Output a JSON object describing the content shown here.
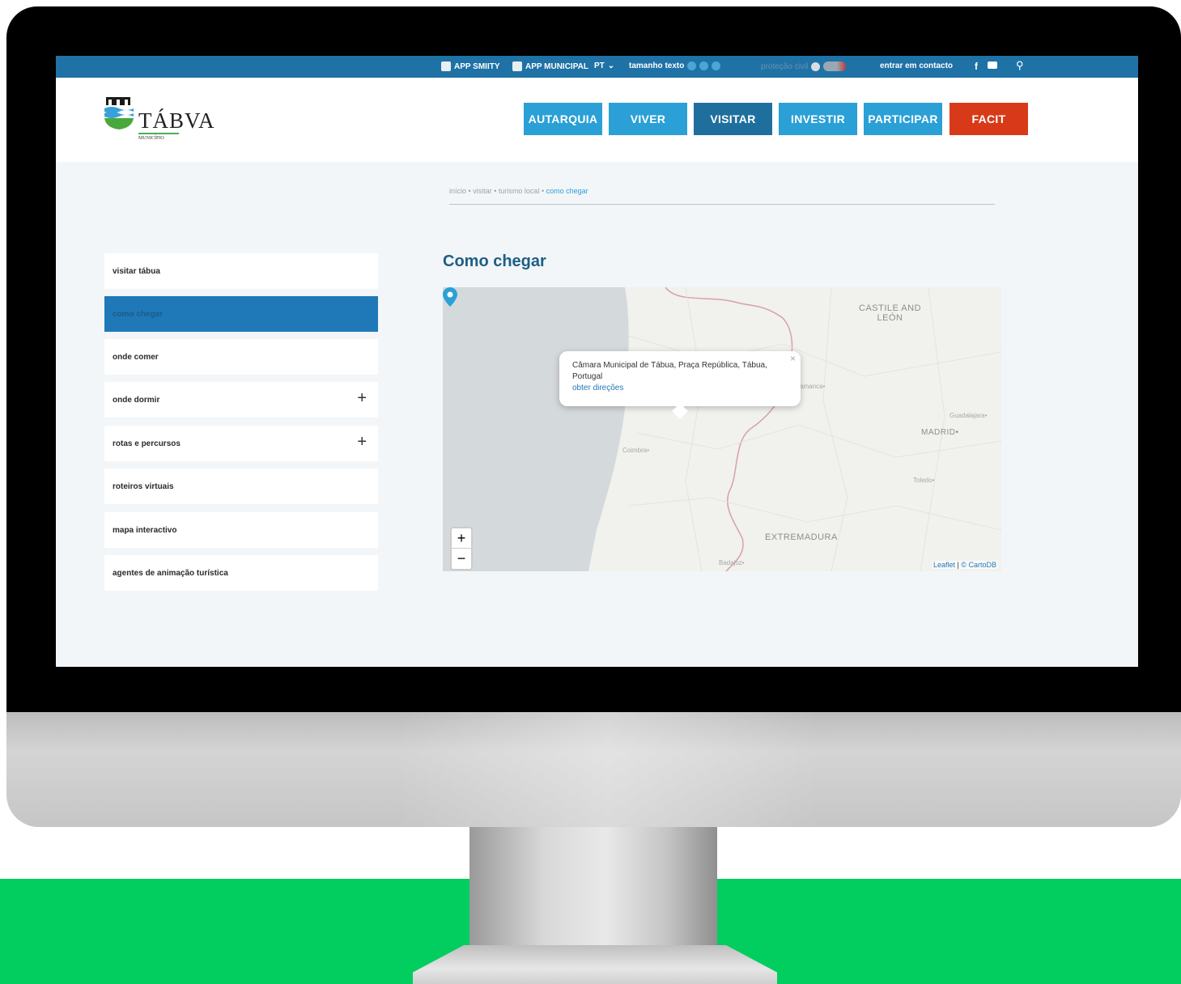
{
  "topbar": {
    "app_smiity": "APP SMIITY",
    "app_municipal": "APP MUNICIPAL",
    "language": "PT",
    "text_size": "tamanho texto",
    "civil_protection": "proteção civil",
    "contact": "entrar em contacto"
  },
  "logo": {
    "name": "TÁBVA",
    "subtitle": "MUNICÍPIO"
  },
  "nav": {
    "autarquia": "AUTARQUIA",
    "viver": "VIVER",
    "visitar": "VISITAR",
    "investir": "INVESTIR",
    "participar": "PARTICIPAR",
    "facit": "FACIT"
  },
  "breadcrumb": {
    "inicio": "início",
    "visitar": "visitar",
    "turismo": "turismo local",
    "current": "como chegar",
    "separator": "•"
  },
  "sidebar": {
    "items": [
      {
        "label": "visitar tábua"
      },
      {
        "label": "como chegar"
      },
      {
        "label": "onde comer"
      },
      {
        "label": "onde dormir"
      },
      {
        "label": "rotas e percursos"
      },
      {
        "label": "roteiros virtuais"
      },
      {
        "label": "mapa interactivo"
      },
      {
        "label": "agentes de animação turística"
      }
    ],
    "expand_symbol": "+"
  },
  "page_title": "Como chegar",
  "map": {
    "labels": {
      "castile_line1": "CASTILE AND",
      "castile_line2": "LEÓN",
      "madrid": "MADRID•",
      "extremadura": "EXTREMADURA",
      "salamanca": "amanca•",
      "guadalajara": "Guadalajara•",
      "toledo": "Toledo•",
      "coimbra": "Coimbra•",
      "badajoz": "Badajoz•"
    },
    "popup": {
      "address": "Câmara Municipal de Tábua, Praça República, Tábua, Portugal",
      "directions": "obter direções",
      "close": "×"
    },
    "zoom_in": "+",
    "zoom_out": "−",
    "attribution_leaflet": "Leaflet",
    "attribution_sep": " | ",
    "attribution_carto": "© CartoDB"
  },
  "colors": {
    "topbar": "#1f72a5",
    "nav_blue": "#2aa0d6",
    "nav_active": "#1f6f9e",
    "nav_red": "#d83a19",
    "sidebar_active": "#1f79b8",
    "page_bg_green": "#02cd5f"
  }
}
